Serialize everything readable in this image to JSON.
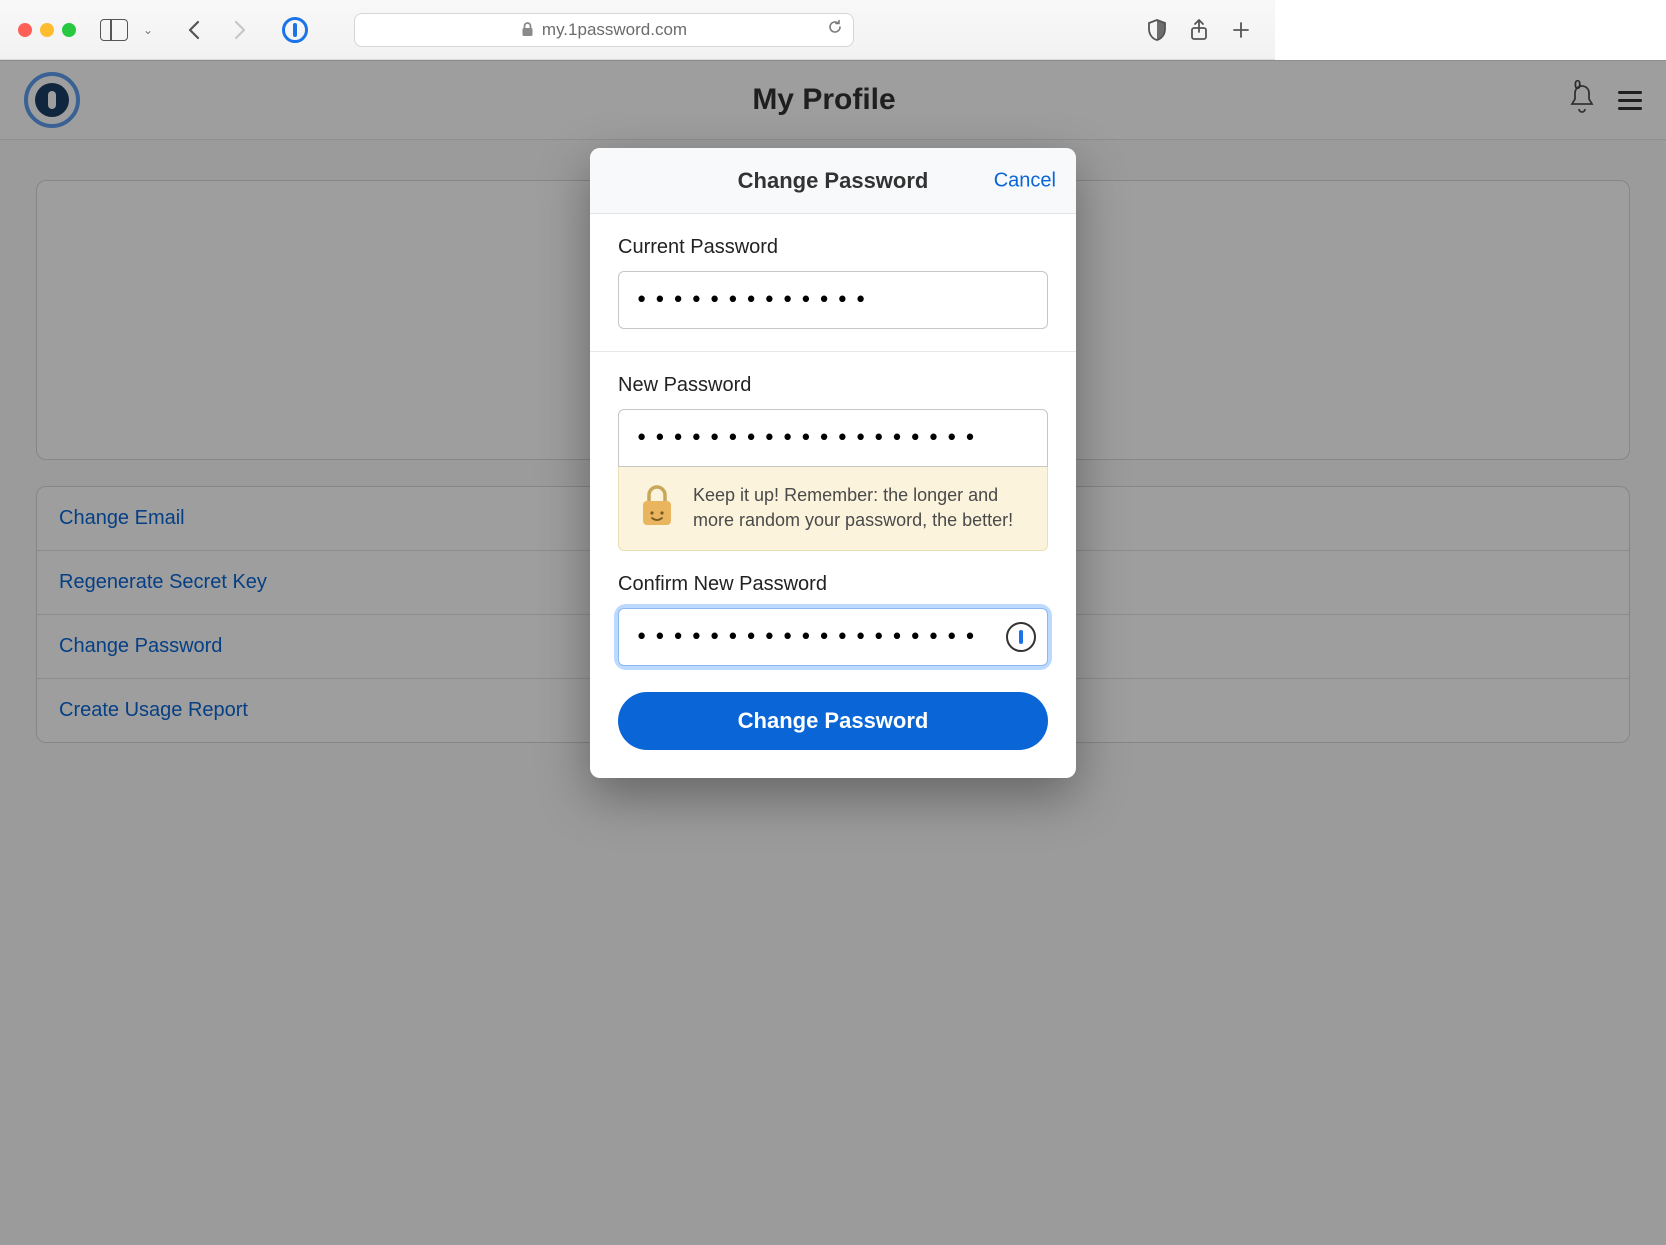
{
  "browser": {
    "url_display": "my.1password.com"
  },
  "header": {
    "page_title": "My Profile",
    "notification_count": "0"
  },
  "sidebar_links": {
    "change_email": "Change Email",
    "regenerate_secret_key": "Regenerate Secret Key",
    "change_password": "Change Password",
    "create_usage_report": "Create Usage Report"
  },
  "modal": {
    "title": "Change Password",
    "cancel": "Cancel",
    "current_label": "Current Password",
    "current_value": "•••••••••••••",
    "new_label": "New Password",
    "new_value": "•••••••••••••••••••",
    "strength_message": "Keep it up! Remember: the longer and more random your password, the better!",
    "confirm_label": "Confirm New Password",
    "confirm_value": "•••••••••••••••••••",
    "submit": "Change Password"
  }
}
